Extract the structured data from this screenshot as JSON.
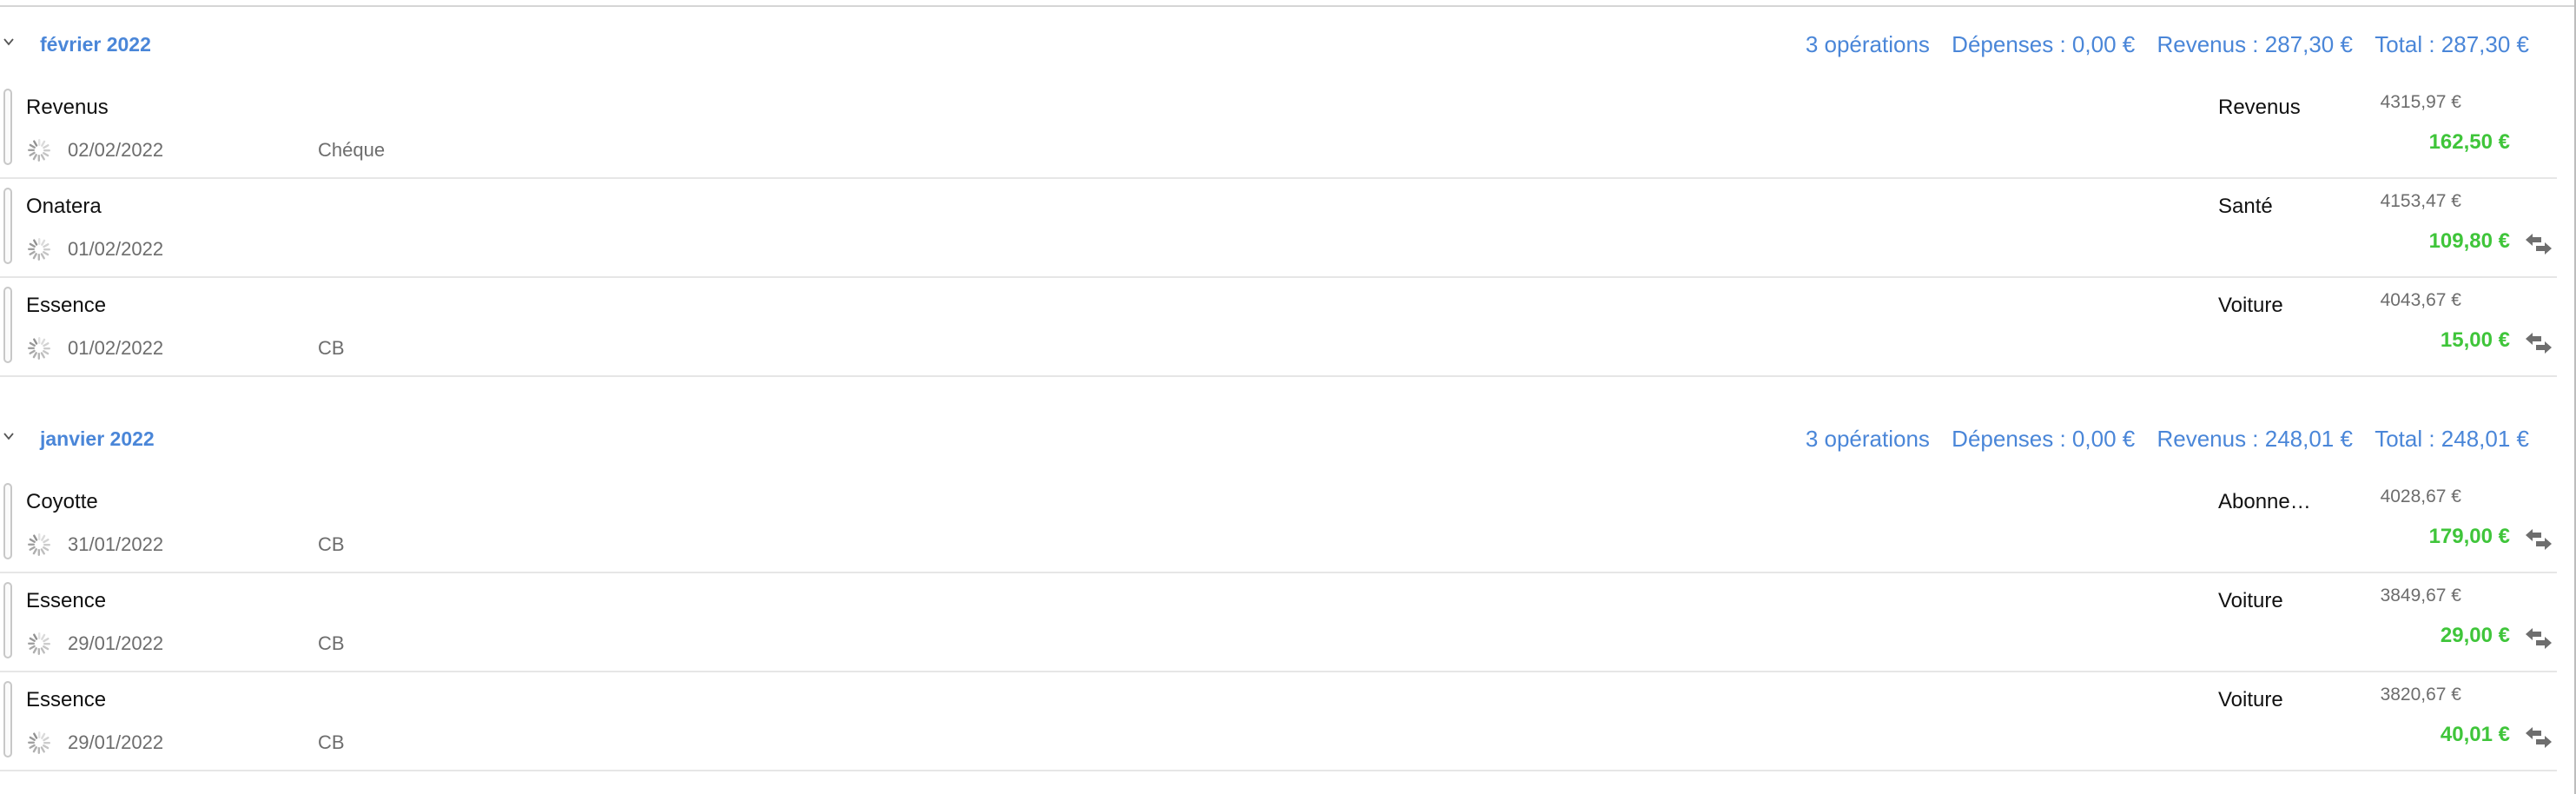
{
  "colors": {
    "accent": "#4a86d8",
    "income": "#3fc53a",
    "muted": "#6d6d6d"
  },
  "months": [
    {
      "label": "février 2022",
      "summary": {
        "count": "3 opérations",
        "expenses": "Dépenses : 0,00 €",
        "income": "Revenus : 287,30 €",
        "total": "Total : 287,30 €"
      },
      "rows": [
        {
          "payee": "Revenus",
          "date": "02/02/2022",
          "mode": "Chéque",
          "category": "Revenus",
          "balance": "4315,97 €",
          "amount": "162,50 €",
          "icon": "loading-spinner-icon",
          "transfer": false
        },
        {
          "payee": "Onatera",
          "date": "01/02/2022",
          "mode": "",
          "category": "Santé",
          "balance": "4153,47 €",
          "amount": "109,80 €",
          "icon": "loading-spinner-icon",
          "transfer": true
        },
        {
          "payee": "Essence",
          "date": "01/02/2022",
          "mode": "CB",
          "category": "Voiture",
          "balance": "4043,67 €",
          "amount": "15,00 €",
          "icon": "loading-spinner-icon",
          "transfer": true
        }
      ]
    },
    {
      "label": "janvier 2022",
      "summary": {
        "count": "3 opérations",
        "expenses": "Dépenses : 0,00 €",
        "income": "Revenus : 248,01 €",
        "total": "Total : 248,01 €"
      },
      "rows": [
        {
          "payee": "Coyotte",
          "date": "31/01/2022",
          "mode": "CB",
          "category": "Abonne…",
          "balance": "4028,67 €",
          "amount": "179,00 €",
          "icon": "loading-spinner-icon",
          "transfer": true
        },
        {
          "payee": "Essence",
          "date": "29/01/2022",
          "mode": "CB",
          "category": "Voiture",
          "balance": "3849,67 €",
          "amount": "29,00 €",
          "icon": "loading-spinner-icon",
          "transfer": true
        },
        {
          "payee": "Essence",
          "date": "29/01/2022",
          "mode": "CB",
          "category": "Voiture",
          "balance": "3820,67 €",
          "amount": "40,01 €",
          "icon": "loading-spinner-icon",
          "transfer": true
        }
      ]
    }
  ]
}
